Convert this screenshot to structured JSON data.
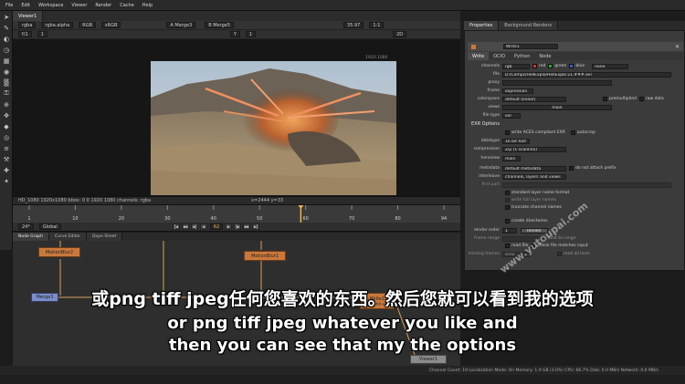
{
  "menu": [
    "File",
    "Edit",
    "Workspace",
    "Viewer",
    "Render",
    "Cache",
    "Help"
  ],
  "toolbar_icons": [
    "pointer-icon",
    "paint-icon",
    "draw-icon",
    "time-icon",
    "channel-icon",
    "color-icon",
    "filter-icon",
    "keyer-icon",
    "merge-icon",
    "transform-icon",
    "3d-icon",
    "views-icon",
    "metadata-icon",
    "toolsets-icon",
    "other-icon",
    "furnace-icon"
  ],
  "viewer": {
    "tab": "Viewer1",
    "controls1": [
      "rgba",
      "rgba.alpha",
      "RGB",
      "sRGB",
      "A  Merge3",
      "B  Merge5",
      "35.97",
      "1:1"
    ],
    "controls2": [
      "f/1",
      "1",
      "Y",
      "1",
      "2D"
    ],
    "resolution_label": "1920,1080",
    "status_left": "HD_1080 1920x1080  bbox: 0 0 1920 1080 channels: rgba",
    "status_right": "x=2444 y=33"
  },
  "timeline": {
    "ticks": [
      "1",
      "10",
      "20",
      "30",
      "40",
      "50",
      "60",
      "70",
      "80",
      "94"
    ],
    "current_frame": "62",
    "fps": "24*",
    "range_mode": "Global",
    "playhead": 0.655
  },
  "node_graph": {
    "tabs": [
      "Node Graph",
      "Curve Editor",
      "Dope Sheet"
    ],
    "nodes": [
      "MotionBlur2",
      "MotionBlur1",
      "Merge3",
      "Write1",
      "Viewer1"
    ],
    "write_file": "v1.###.exr"
  },
  "properties": {
    "tabs": [
      "Properties",
      "Background Renders"
    ],
    "node_name": "Write1",
    "subtabs": [
      "Write",
      "OCIO",
      "Python",
      "Node"
    ],
    "rows": {
      "channels": {
        "label": "channels",
        "value": "rgb",
        "extra": [
          "red",
          "green",
          "blue",
          "none"
        ]
      },
      "file": {
        "label": "file",
        "value": "D:/Comps/HellExplo/HellExplo.v1.###.exr"
      },
      "proxy": {
        "label": "proxy",
        "value": ""
      },
      "frame": {
        "label": "frame",
        "value": "expression"
      },
      "colorspace": {
        "label": "colorspace",
        "value": "default (linear)",
        "extra": [
          "premultiplied",
          "raw data"
        ]
      },
      "views": {
        "label": "views",
        "value": "main"
      },
      "file_type": {
        "label": "file type",
        "value": "exr"
      }
    },
    "exr_section": "EXR Options",
    "exr_rows": {
      "aces": {
        "label": "write ACES compliant EXR",
        "extra": "autocrop"
      },
      "datatype": {
        "label": "datatype",
        "value": "16 bit half"
      },
      "compression": {
        "label": "compression",
        "value": "Zip (1 scanline)"
      },
      "heroview": {
        "label": "heroview",
        "value": "main"
      },
      "metadata": {
        "label": "metadata",
        "value": "default metadata",
        "extra": "do not attach prefix"
      },
      "interleave": {
        "label": "interleave",
        "value": "channels, layers and views"
      },
      "first_part": {
        "label": "first part",
        "value": ""
      }
    },
    "checks": [
      "standard layer name format",
      "write full layer names",
      "truncate channel names"
    ],
    "create_dirs": "create directories",
    "render_order": {
      "label": "render order",
      "value": "1",
      "button": "Render"
    },
    "frame_range": {
      "label": "frame range",
      "extra": "limit to range"
    },
    "read_file": {
      "label": "read file",
      "extra": "check file matches input"
    },
    "missing_frames": {
      "label": "missing frames",
      "value": "error",
      "extra": "read all lines"
    }
  },
  "bottom_status": "Channel Count: 19  Localization Mode: On  Memory: 1.9 GB (3.0%)  CPU: 66.7%  Disk: 0.0 MB/s  Network: 0.0 MB/s",
  "subtitles": {
    "cn": "或png tiff jpeg任何您喜欢的东西。然后您就可以看到我的选项",
    "en1": "or png tiff jpeg whatever you like and",
    "en2": "then you can see that my the options"
  },
  "watermark": "www.yutoupai.com"
}
